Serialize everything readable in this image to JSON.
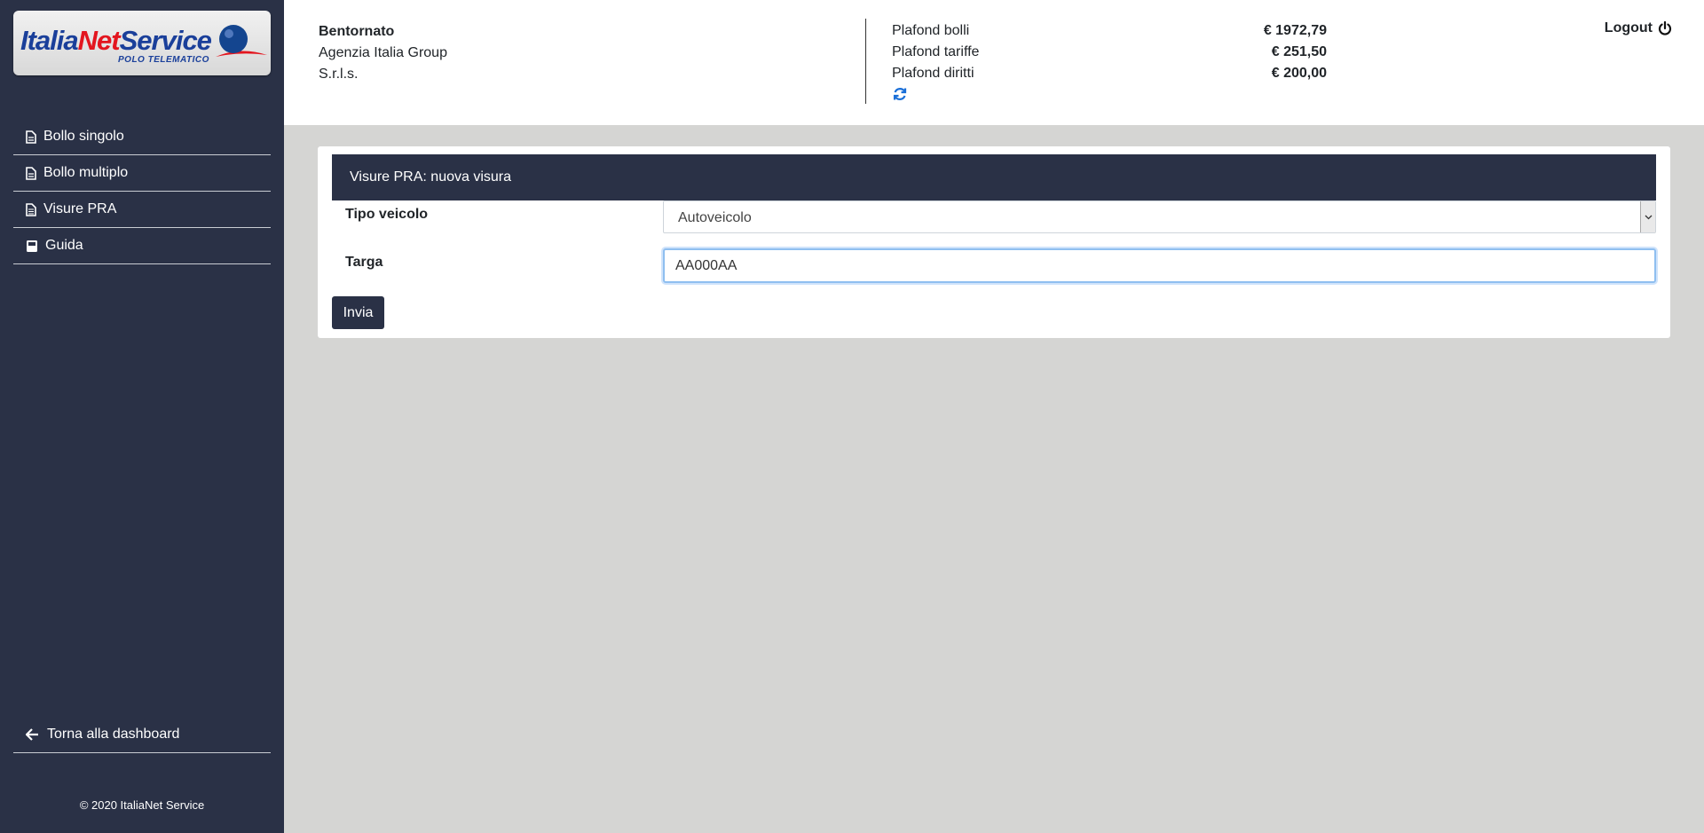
{
  "brand": {
    "name_part1": "Italia",
    "name_part2": "Net",
    "name_part3": "Service",
    "tagline": "POLO TELEMATICO"
  },
  "sidebar": {
    "items": [
      {
        "label": "Bollo singolo",
        "icon": "file-icon"
      },
      {
        "label": "Bollo multiplo",
        "icon": "file-icon"
      },
      {
        "label": "Visure PRA",
        "icon": "file-text-icon"
      },
      {
        "label": "Guida",
        "icon": "book-icon"
      }
    ],
    "back_label": "Torna alla dashboard",
    "copyright": "© 2020 ItaliaNet Service"
  },
  "header": {
    "welcome": "Bentornato",
    "company_line1": "Agenzia Italia Group",
    "company_line2": "S.r.l.s.",
    "plafond": [
      {
        "label": "Plafond bolli",
        "value": "€ 1972,79"
      },
      {
        "label": "Plafond tariffe",
        "value": "€ 251,50"
      },
      {
        "label": "Plafond diritti",
        "value": "€ 200,00"
      }
    ],
    "logout_label": "Logout"
  },
  "form": {
    "title": "Visure PRA: nuova visura",
    "tipo_label": "Tipo veicolo",
    "tipo_value": "Autoveicolo",
    "targa_label": "Targa",
    "targa_value": "AA000AA",
    "submit_label": "Invia"
  },
  "colors": {
    "sidebar_bg": "#2a3146",
    "content_bg": "#d5d5d3",
    "accent_blue": "#1a6fd8"
  }
}
